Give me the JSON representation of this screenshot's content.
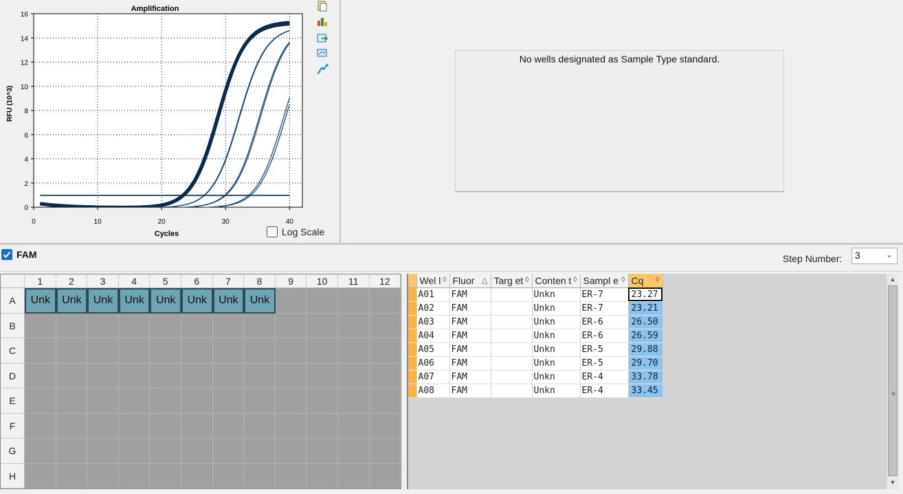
{
  "chart": {
    "title": "Amplification",
    "xlabel": "Cycles",
    "ylabel": "RFU (10^3)",
    "xticks": [
      "0",
      "10",
      "20",
      "30",
      "40"
    ],
    "yticks": [
      "0",
      "2",
      "4",
      "6",
      "8",
      "10",
      "12",
      "14",
      "16"
    ],
    "log_scale_label": "Log Scale",
    "tool_icons": [
      "copy-icon",
      "chart-settings-icon",
      "export-icon",
      "print-icon",
      "view-curves-icon"
    ]
  },
  "chart_data": {
    "type": "line",
    "x_range": [
      0,
      42
    ],
    "y_range": [
      0,
      16
    ],
    "threshold": 0.98,
    "grid": true,
    "curve_color": "#1f4e79",
    "highlight_color": "#0d2a4a",
    "series": [
      {
        "cq": 23.27,
        "plateau": 15.4,
        "slope": 2.1,
        "highlighted": true
      },
      {
        "cq": 23.21,
        "plateau": 15.3,
        "slope": 2.1,
        "highlighted": true
      },
      {
        "cq": 26.5,
        "plateau": 15.0,
        "slope": 2.1,
        "highlighted": false
      },
      {
        "cq": 26.59,
        "plateau": 15.0,
        "slope": 2.1,
        "highlighted": false
      },
      {
        "cq": 29.88,
        "plateau": 15.2,
        "slope": 2.1,
        "highlighted": false
      },
      {
        "cq": 29.7,
        "plateau": 15.2,
        "slope": 2.1,
        "highlighted": false
      },
      {
        "cq": 33.78,
        "plateau": 14.8,
        "slope": 2.1,
        "highlighted": false
      },
      {
        "cq": 33.45,
        "plateau": 14.8,
        "slope": 2.1,
        "highlighted": false
      }
    ]
  },
  "standard_panel": {
    "message": "No wells designated as Sample Type standard."
  },
  "fluor_bar": {
    "fam_label": "FAM",
    "fam_checked": true,
    "step_label": "Step Number:",
    "step_value": "3"
  },
  "plate": {
    "columns": [
      "1",
      "2",
      "3",
      "4",
      "5",
      "6",
      "7",
      "8",
      "9",
      "10",
      "11",
      "12"
    ],
    "rows": [
      "A",
      "B",
      "C",
      "D",
      "E",
      "F",
      "G",
      "H"
    ],
    "filled_label": "Unk",
    "filled_row": "A",
    "filled_count": 8,
    "well_color": "#6fa4b4",
    "empty_color": "#a0a0a0"
  },
  "table": {
    "headers": [
      "Wel\nl",
      "Fluor",
      "Targ\net",
      "Conten\nt",
      "Sampl\ne",
      "Cq"
    ],
    "sort_glyphs": [
      "◊",
      "△",
      "◊",
      "◊",
      "◊",
      "◊"
    ],
    "rows": [
      {
        "well": "A01",
        "fluor": "FAM",
        "target": "",
        "content": "Unkn",
        "sample": "ER-7",
        "cq": "23.27"
      },
      {
        "well": "A02",
        "fluor": "FAM",
        "target": "",
        "content": "Unkn",
        "sample": "ER-7",
        "cq": "23.21"
      },
      {
        "well": "A03",
        "fluor": "FAM",
        "target": "",
        "content": "Unkn",
        "sample": "ER-6",
        "cq": "26.50"
      },
      {
        "well": "A04",
        "fluor": "FAM",
        "target": "",
        "content": "Unkn",
        "sample": "ER-6",
        "cq": "26.59"
      },
      {
        "well": "A05",
        "fluor": "FAM",
        "target": "",
        "content": "Unkn",
        "sample": "ER-5",
        "cq": "29.88"
      },
      {
        "well": "A06",
        "fluor": "FAM",
        "target": "",
        "content": "Unkn",
        "sample": "ER-5",
        "cq": "29.70"
      },
      {
        "well": "A07",
        "fluor": "FAM",
        "target": "",
        "content": "Unkn",
        "sample": "ER-4",
        "cq": "33.78"
      },
      {
        "well": "A08",
        "fluor": "FAM",
        "target": "",
        "content": "Unkn",
        "sample": "ER-4",
        "cq": "33.45"
      }
    ],
    "active_row": 0
  }
}
